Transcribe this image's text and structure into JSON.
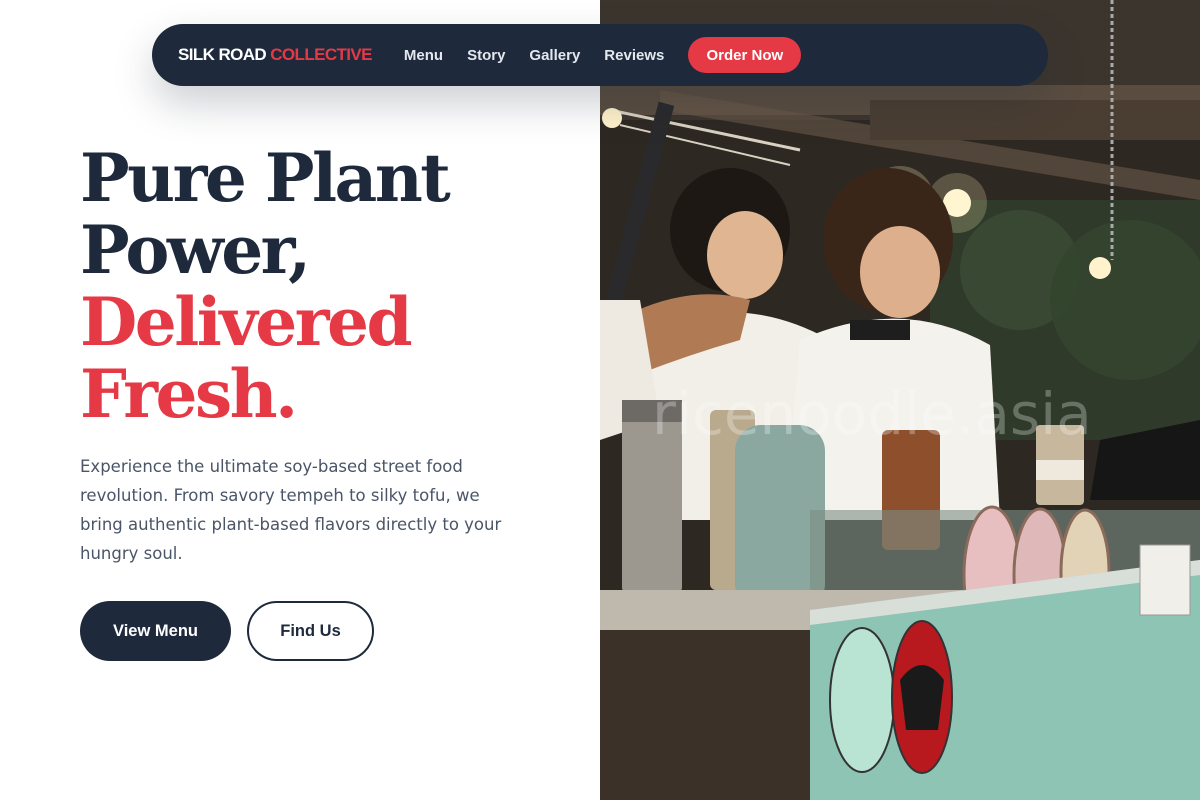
{
  "nav": {
    "brand_primary": "SILK ROAD",
    "brand_accent": "COLLECTIVE",
    "links": [
      "Menu",
      "Story",
      "Gallery",
      "Reviews"
    ],
    "cta": "Order Now"
  },
  "hero": {
    "line1": "Pure Plant",
    "line2": "Power,",
    "line3": "Delivered",
    "line4": "Fresh.",
    "description": "Experience the ultimate soy-based street food revolution. From savory tempeh to silky tofu, we bring authentic plant-based flavors directly to your hungry soul.",
    "primary_button": "View Menu",
    "secondary_button": "Find Us"
  },
  "photo": {
    "watermark": "ricenoodle.asia"
  },
  "colors": {
    "navy": "#1e2a3c",
    "accent_red": "#e63946",
    "body_text": "#4a5568",
    "background": "#ffffff"
  }
}
